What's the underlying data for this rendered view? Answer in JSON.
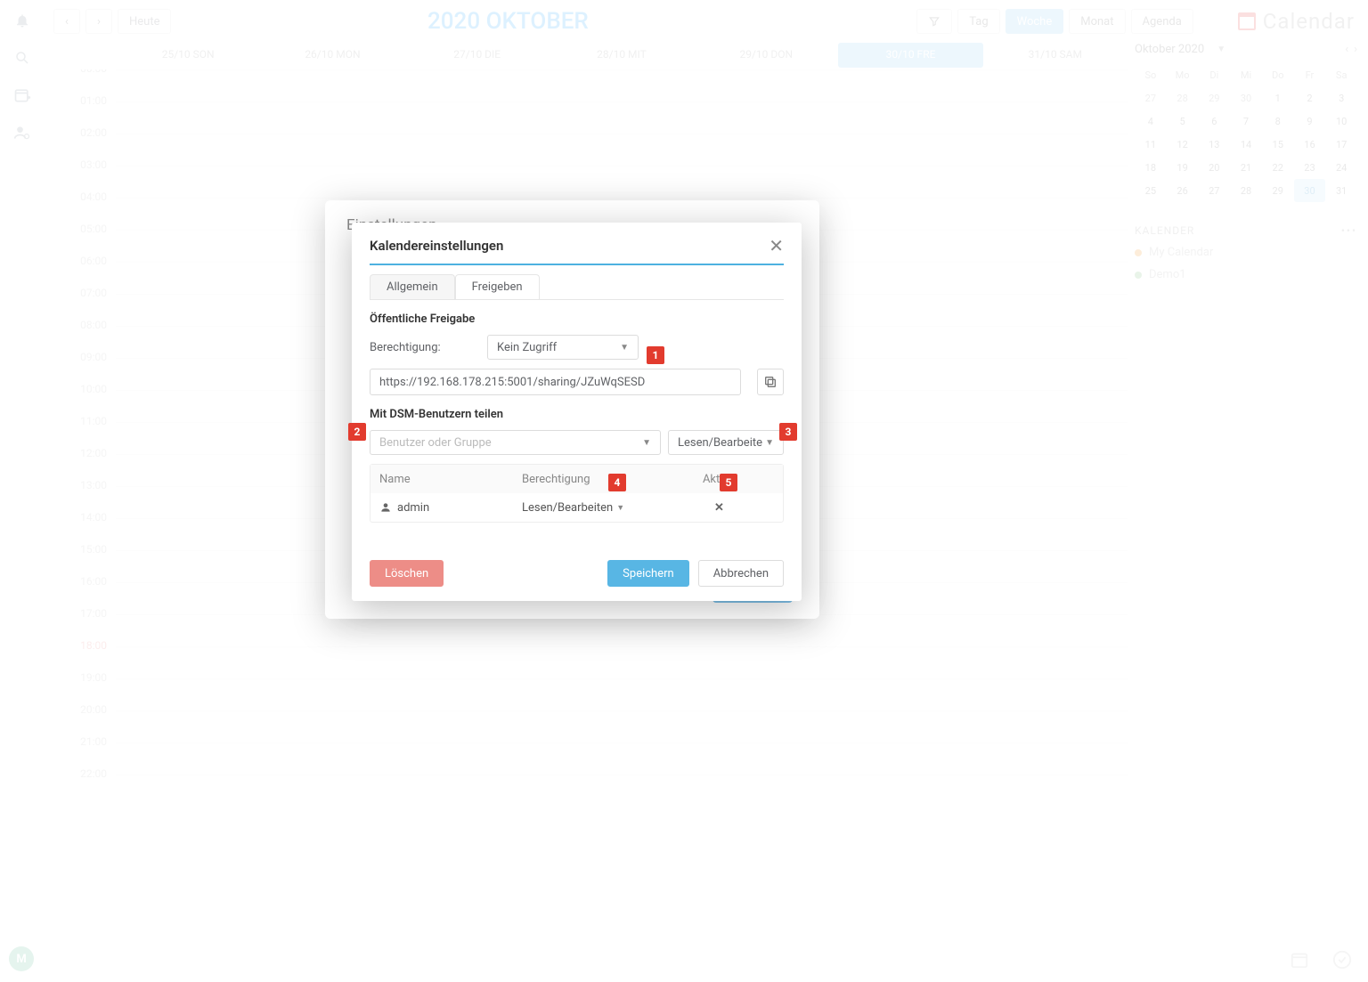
{
  "toolbar": {
    "today_label": "Heute",
    "title": "2020 OKTOBER",
    "views": {
      "day": "Tag",
      "week": "Woche",
      "month": "Monat",
      "agenda": "Agenda"
    }
  },
  "brand": "Calendar",
  "week_days": [
    {
      "label": "25/10 SON"
    },
    {
      "label": "26/10 MON"
    },
    {
      "label": "27/10 DIE"
    },
    {
      "label": "28/10 MIT"
    },
    {
      "label": "29/10 DON"
    },
    {
      "label": "30/10 FRE",
      "active": true
    },
    {
      "label": "31/10 SAM"
    }
  ],
  "hours": [
    "00:00",
    "01:00",
    "02:00",
    "03:00",
    "04:00",
    "05:00",
    "06:00",
    "07:00",
    "08:00",
    "09:00",
    "10:00",
    "11:00",
    "12:00",
    "13:00",
    "14:00",
    "15:00",
    "16:00",
    "17:00",
    "18:00",
    "19:00",
    "20:00",
    "21:00",
    "22:00"
  ],
  "current_hour_index": 18,
  "mini": {
    "label": "Oktober 2020",
    "dow": [
      "So",
      "Mo",
      "Di",
      "Mi",
      "Do",
      "Fr",
      "Sa"
    ],
    "weeks": [
      [
        {
          "n": "27"
        },
        {
          "n": "28"
        },
        {
          "n": "29"
        },
        {
          "n": "30"
        },
        {
          "n": "1",
          "in": true
        },
        {
          "n": "2",
          "in": true
        },
        {
          "n": "3",
          "in": true
        }
      ],
      [
        {
          "n": "4",
          "in": true
        },
        {
          "n": "5",
          "in": true
        },
        {
          "n": "6",
          "in": true
        },
        {
          "n": "7",
          "in": true
        },
        {
          "n": "8",
          "in": true
        },
        {
          "n": "9",
          "in": true
        },
        {
          "n": "10",
          "in": true
        }
      ],
      [
        {
          "n": "11",
          "in": true
        },
        {
          "n": "12",
          "in": true
        },
        {
          "n": "13",
          "in": true
        },
        {
          "n": "14",
          "in": true
        },
        {
          "n": "15",
          "in": true
        },
        {
          "n": "16",
          "in": true
        },
        {
          "n": "17",
          "in": true
        }
      ],
      [
        {
          "n": "18",
          "in": true
        },
        {
          "n": "19",
          "in": true
        },
        {
          "n": "20",
          "in": true
        },
        {
          "n": "21",
          "in": true
        },
        {
          "n": "22",
          "in": true
        },
        {
          "n": "23",
          "in": true
        },
        {
          "n": "24",
          "in": true
        }
      ],
      [
        {
          "n": "25",
          "in": true
        },
        {
          "n": "26",
          "in": true
        },
        {
          "n": "27",
          "in": true
        },
        {
          "n": "28",
          "in": true
        },
        {
          "n": "29",
          "in": true
        },
        {
          "n": "30",
          "in": true,
          "today": true
        },
        {
          "n": "31",
          "in": true
        }
      ]
    ]
  },
  "kalender": {
    "title": "KALENDER",
    "items": [
      {
        "name": "My Calendar",
        "color": "orange"
      },
      {
        "name": "Demo1",
        "color": "green"
      }
    ]
  },
  "behind_title": "Einstellungen",
  "modal": {
    "title": "Kalendereinstellungen",
    "tabs": {
      "general": "Allgemein",
      "share": "Freigeben"
    },
    "public_section": "Öffentliche Freigabe",
    "perm_label": "Berechtigung:",
    "perm_value": "Kein Zugriff",
    "url": "https://192.168.178.215:5001/sharing/JZuWqSESD",
    "dsm_section": "Mit DSM-Benutzern teilen",
    "user_placeholder": "Benutzer oder Gruppe",
    "access_value": "Lesen/Bearbeiten",
    "table": {
      "cols": {
        "name": "Name",
        "perm": "Berechtigung",
        "action": "Aktion"
      },
      "rows": [
        {
          "name": "admin",
          "perm": "Lesen/Bearbeiten"
        }
      ]
    },
    "buttons": {
      "delete": "Löschen",
      "save": "Speichern",
      "cancel": "Abbrechen"
    }
  },
  "markers": {
    "m1": "1",
    "m2": "2",
    "m3": "3",
    "m4": "4",
    "m5": "5"
  },
  "avatar": "M"
}
